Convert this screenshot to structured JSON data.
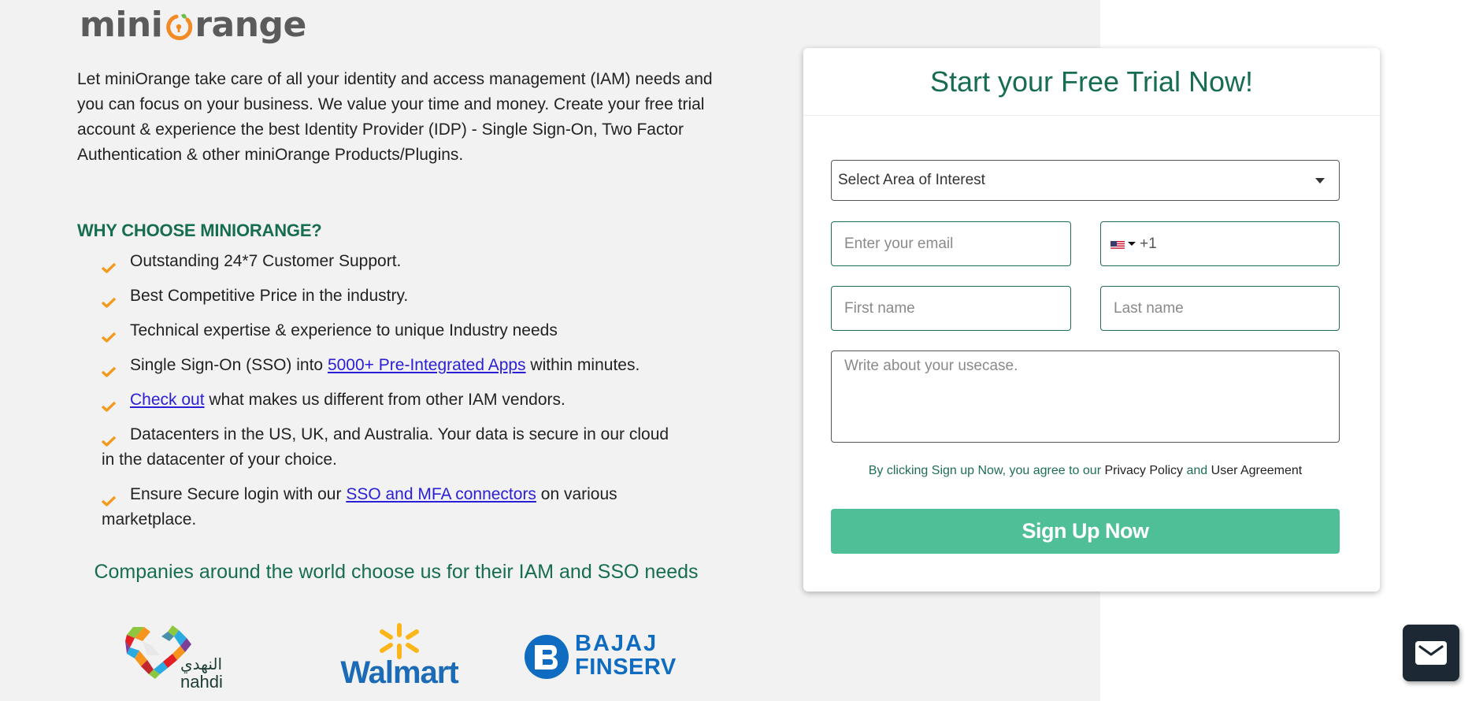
{
  "brand": {
    "logo_prefix": "mini",
    "logo_suffix": "range",
    "logo_alt": "miniOrange",
    "accent_orange": "#f28b25",
    "accent_green": "#176d4f",
    "button_green": "#4fbf98"
  },
  "intro": {
    "text": "Let miniOrange take care of all your identity and access management (IAM) needs and you can focus on your business. We value your time and money. Create your free trial account & experience the best Identity Provider (IDP) - Single Sign-On, Two Factor Authentication & other miniOrange Products/Plugins."
  },
  "why": {
    "heading": "WHY CHOOSE MINIORANGE?",
    "items": [
      {
        "before": "Outstanding 24*7 Customer Support.",
        "link": "",
        "after": ""
      },
      {
        "before": "Best Competitive Price in the industry.",
        "link": "",
        "after": ""
      },
      {
        "before": "Technical expertise & experience to unique Industry needs",
        "link": "",
        "after": ""
      },
      {
        "before": "Single Sign-On (SSO) into ",
        "link": "5000+ Pre-Integrated Apps",
        "after": " within minutes."
      },
      {
        "before": "",
        "link": "Check out",
        "after": " what makes us different from other IAM vendors."
      },
      {
        "before": "Datacenters in the US, UK, and Australia. Your data is secure in our cloud in the datacenter of your choice.",
        "link": "",
        "after": ""
      },
      {
        "before": "Ensure Secure login with our ",
        "link": "SSO and MFA connectors",
        "after": " on various marketplace."
      }
    ]
  },
  "companies": {
    "heading": "Companies around the world choose us for their IAM and SSO needs",
    "logos": [
      {
        "name": "nahdi",
        "arabic": "النهدي",
        "latin": "nahdi"
      },
      {
        "name": "walmart",
        "text": "Walmart"
      },
      {
        "name": "bajaj-finserv",
        "line1": "BAJAJ",
        "line2": "FINSERV"
      }
    ]
  },
  "form": {
    "title": "Start your Free Trial Now!",
    "area_select": {
      "value": "Select Area of Interest"
    },
    "email": {
      "placeholder": "Enter your email"
    },
    "phone": {
      "country": "US",
      "dial_code": "+1"
    },
    "first_name": {
      "placeholder": "First name"
    },
    "last_name": {
      "placeholder": "Last name"
    },
    "usecase": {
      "placeholder": "Write about your usecase."
    },
    "terms": {
      "prefix": "By clicking Sign up Now, you agree to our ",
      "privacy": "Privacy Policy",
      "and": " and ",
      "agreement": "User Agreement"
    },
    "submit_label": "Sign Up Now"
  },
  "widgets": {
    "mail_icon": "mail-icon"
  }
}
